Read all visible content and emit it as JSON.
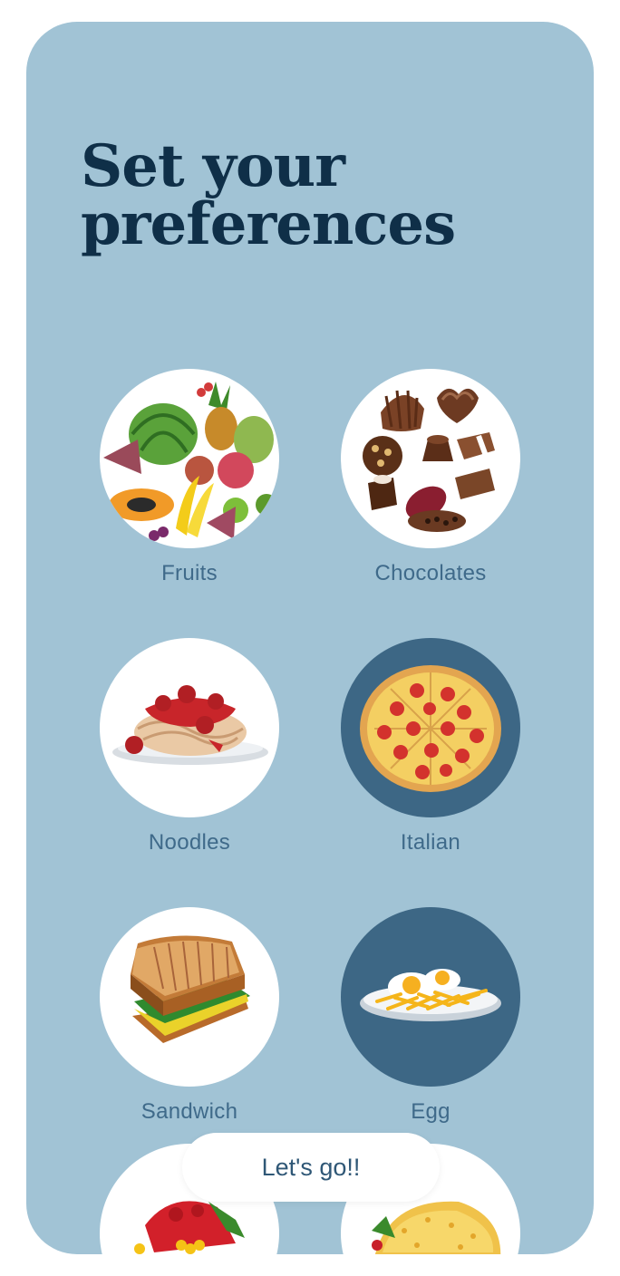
{
  "title": {
    "line1": "Set  your",
    "line2": "preferences"
  },
  "categories": [
    {
      "label": "Fruits",
      "icon": "fruits-icon",
      "selected": false
    },
    {
      "label": "Chocolates",
      "icon": "chocolates-icon",
      "selected": false
    },
    {
      "label": "Noodles",
      "icon": "noodles-icon",
      "selected": false
    },
    {
      "label": "Italian",
      "icon": "pizza-icon",
      "selected": true
    },
    {
      "label": "Sandwich",
      "icon": "sandwich-icon",
      "selected": false
    },
    {
      "label": "Egg",
      "icon": "egg-icon",
      "selected": true
    },
    {
      "label": "",
      "icon": "tomato-dish-icon",
      "selected": false
    },
    {
      "label": "",
      "icon": "taco-icon",
      "selected": false
    }
  ],
  "cta": {
    "label": "Let's go!!"
  },
  "colors": {
    "background": "#a1c3d5",
    "title": "#0f2f48",
    "label": "#3f6a8a",
    "selected_circle": "#3d6785",
    "circle": "#ffffff"
  }
}
